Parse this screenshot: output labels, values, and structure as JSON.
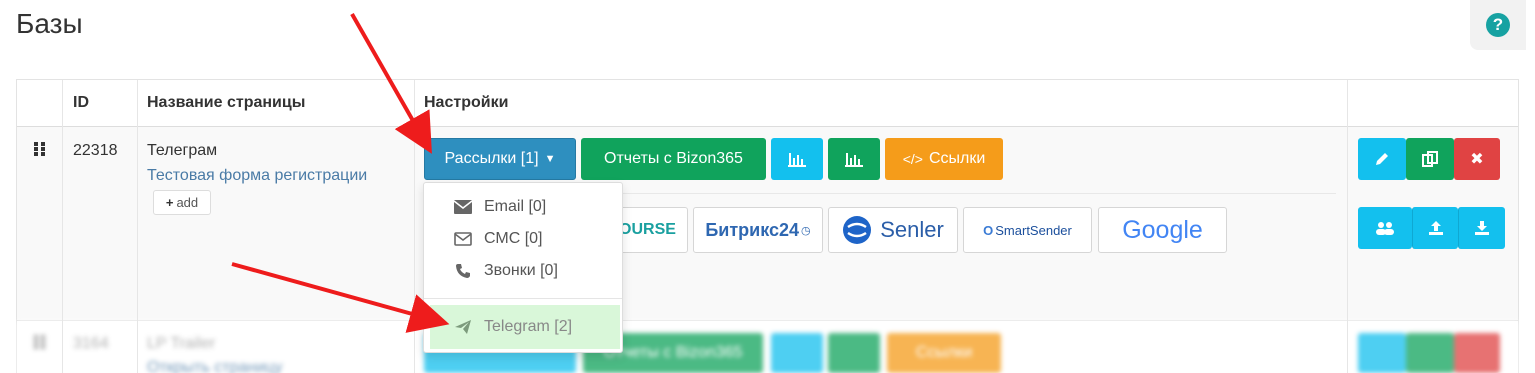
{
  "page": {
    "title": "Базы"
  },
  "help": {
    "label": "?"
  },
  "table": {
    "headers": {
      "id": "ID",
      "name": "Название страницы",
      "settings": "Настройки"
    },
    "row1": {
      "id": "22318",
      "name": "Телеграм",
      "link": "Тестовая форма регистрации",
      "add": "add",
      "buttons": {
        "mailings": "Рассылки [1]",
        "reports": "Отчеты с Bizon365",
        "links": "Ссылки"
      },
      "integrations": [
        "OURSE",
        "Битрикс24",
        "Senler",
        "SmartSender",
        "Google"
      ]
    },
    "row2": {
      "id": "3164",
      "name": "LP Trailer",
      "link": "Открыть страницу",
      "reports": "Отчеты с Bizon365",
      "links": "Ссылки"
    }
  },
  "dropdown": {
    "items": [
      {
        "label": "Email [0]",
        "icon": "envelope-icon"
      },
      {
        "label": "СМС [0]",
        "icon": "envelope-outline-icon"
      },
      {
        "label": "Звонки [0]",
        "icon": "phone-icon"
      },
      {
        "label": "Telegram [2]",
        "icon": "paper-plane-icon"
      }
    ]
  },
  "colors": {
    "blue": "#2e8fbf",
    "green": "#10a35c",
    "cyan": "#13c0ee",
    "orange": "#f59c1a",
    "red": "#e04343",
    "arrow": "#ee1c1c"
  }
}
